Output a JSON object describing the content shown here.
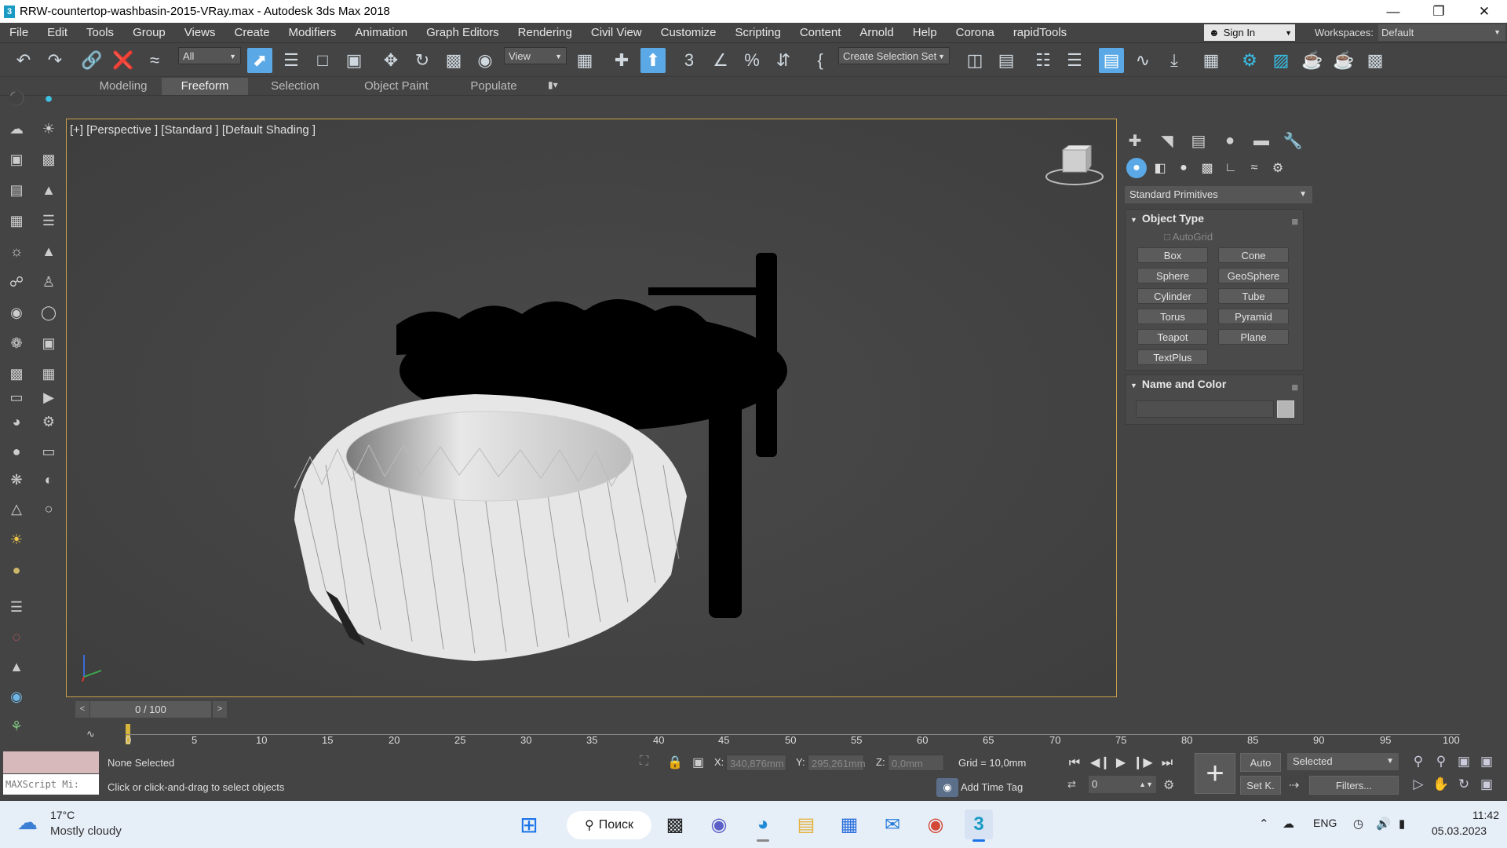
{
  "window": {
    "title": "RRW-countertop-washbasin-2015-VRay.max - Autodesk 3ds Max 2018",
    "app_icon": "3",
    "controls": [
      "minimize-icon",
      "restore-icon",
      "close-icon"
    ]
  },
  "menu": [
    "File",
    "Edit",
    "Tools",
    "Group",
    "Views",
    "Create",
    "Modifiers",
    "Animation",
    "Graph Editors",
    "Rendering",
    "Civil View",
    "Customize",
    "Scripting",
    "Content",
    "Arnold",
    "Help",
    "Corona",
    "rapidTools"
  ],
  "account": {
    "sign_in": "Sign In",
    "workspaces_label": "Workspaces:",
    "workspace": "Default"
  },
  "toolbar": {
    "selection_filter": "All",
    "reference_coord": "View",
    "selection_set": "Create Selection Set"
  },
  "ribbon_tabs": [
    "Modeling",
    "Freeform",
    "Selection",
    "Object Paint",
    "Populate"
  ],
  "ribbon_selected": "Freeform",
  "viewport": {
    "label": "[+] [Perspective ] [Standard ] [Default Shading ]"
  },
  "command_panel": {
    "category": "Standard Primitives",
    "object_type_title": "Object Type",
    "autogrid": "AutoGrid",
    "buttons": [
      "Box",
      "Cone",
      "Sphere",
      "GeoSphere",
      "Cylinder",
      "Tube",
      "Torus",
      "Pyramid",
      "Teapot",
      "Plane",
      "TextPlus"
    ],
    "name_color_title": "Name and Color",
    "swatch_color": "#b5b5b5"
  },
  "timeline": {
    "slider": "0 / 100",
    "prev": "<",
    "next": ">",
    "ticks": [
      "0",
      "5",
      "10",
      "15",
      "20",
      "25",
      "30",
      "35",
      "40",
      "45",
      "50",
      "55",
      "60",
      "65",
      "70",
      "75",
      "80",
      "85",
      "90",
      "95",
      "100"
    ]
  },
  "status": {
    "maxscript": "MAXScript Mi:",
    "selection": "None Selected",
    "prompt": "Click or click-and-drag to select objects",
    "x_label": "X:",
    "x": "340,876mm",
    "y_label": "Y:",
    "y": "295,261mm",
    "z_label": "Z:",
    "z": "0,0mm",
    "grid": "Grid = 10,0mm",
    "add_time_tag": "Add Time Tag",
    "frame": "0",
    "auto": "Auto",
    "set_key": "Set K.",
    "key_filter": "Selected",
    "filters": "Filters..."
  },
  "taskbar": {
    "temp": "17°C",
    "weather": "Mostly cloudy",
    "search": "Поиск",
    "lang": "ENG",
    "time": "11:42",
    "date": "05.03.2023"
  }
}
